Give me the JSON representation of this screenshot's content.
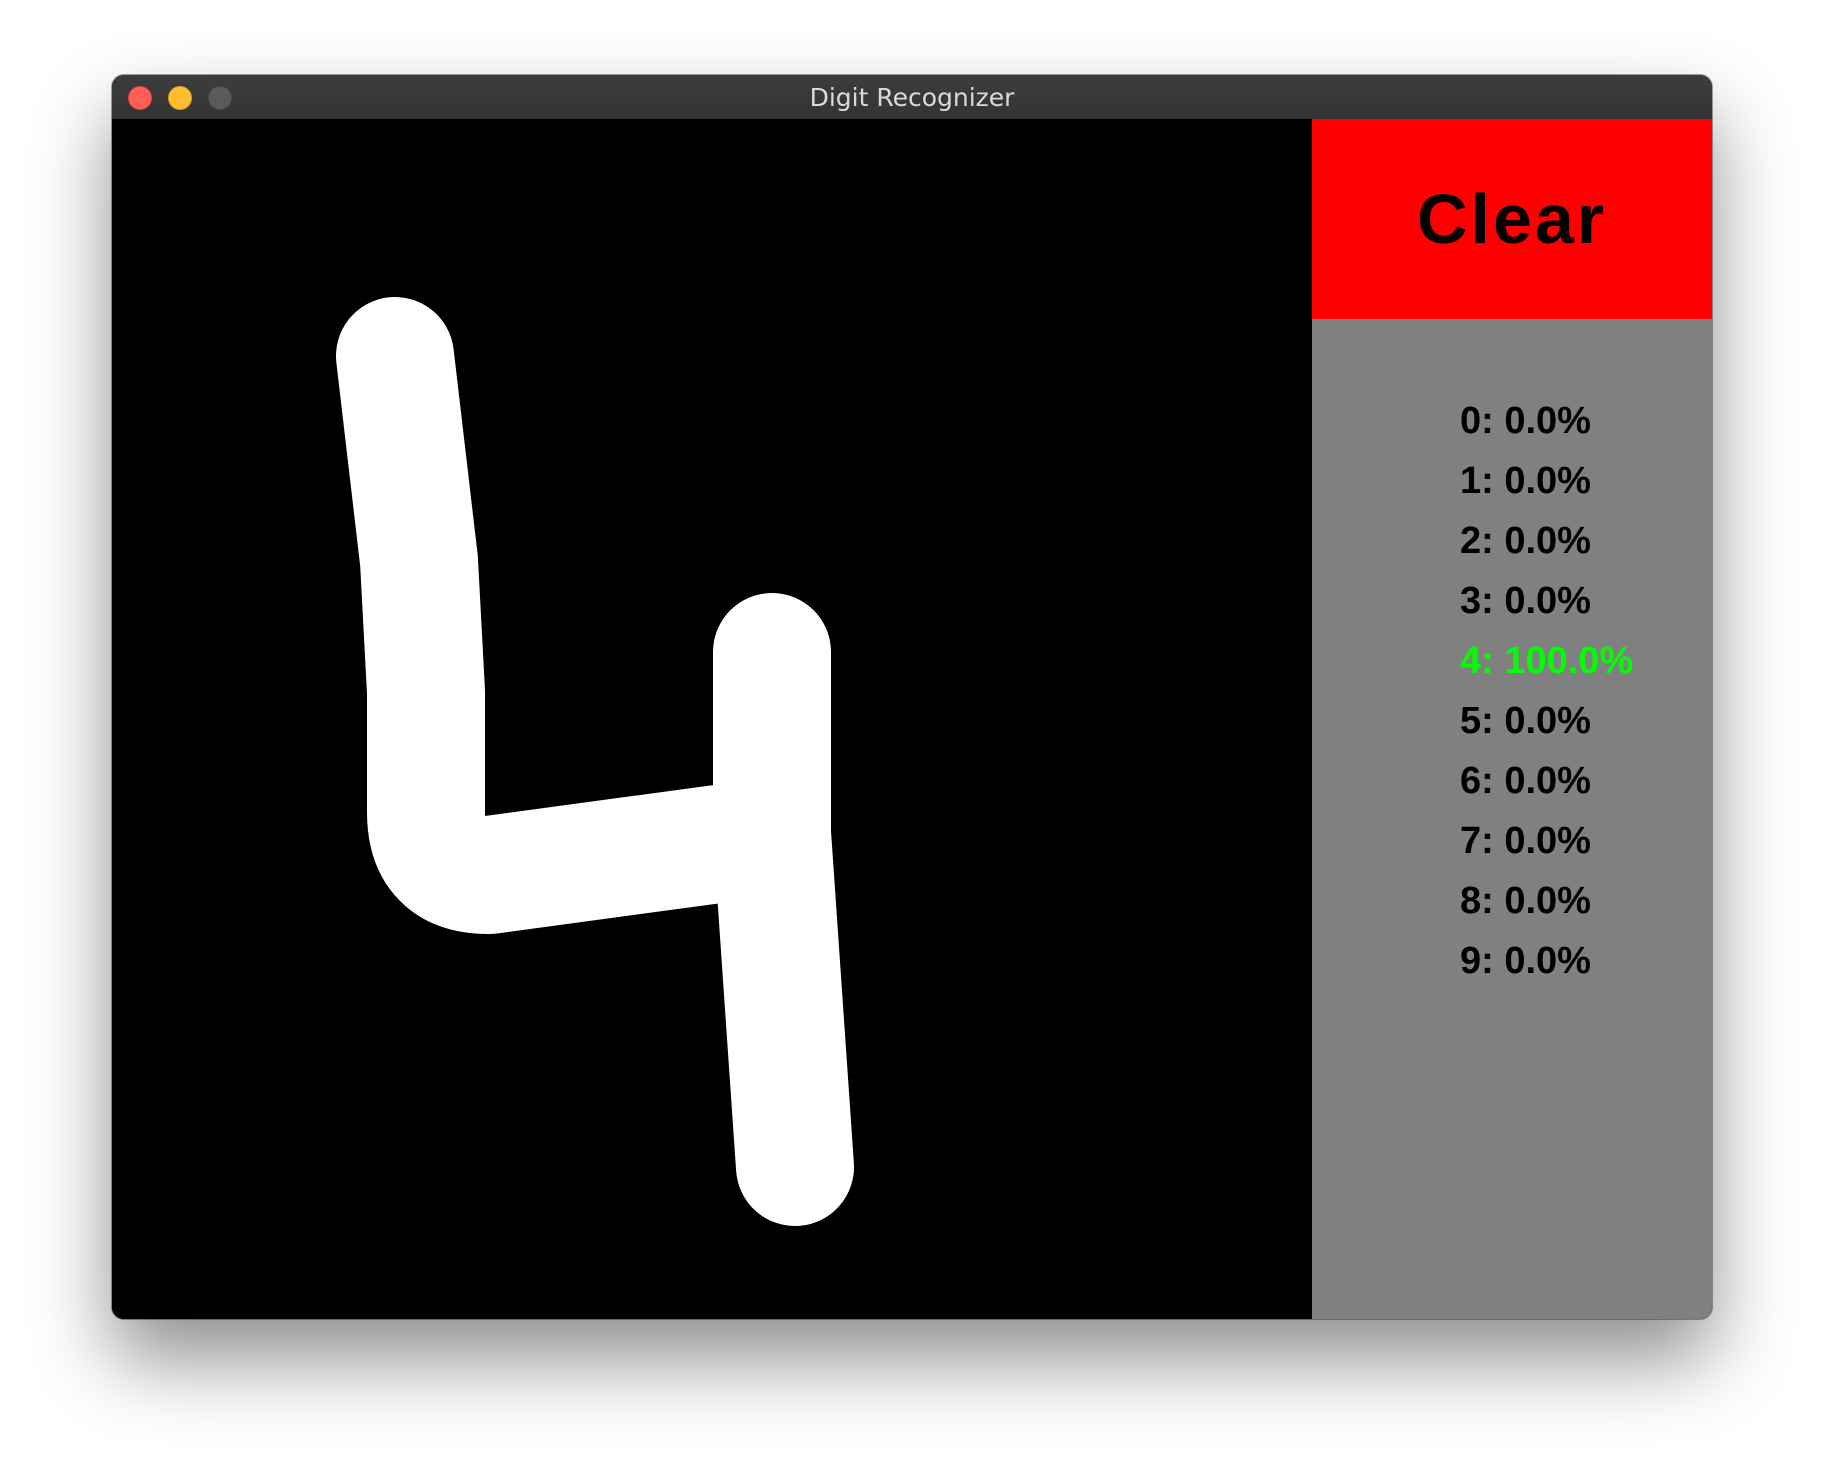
{
  "window": {
    "title": "Digit Recognizer"
  },
  "canvas": {
    "content": "handwritten digit stroke",
    "stroke_color": "#ffffff",
    "background": "#000000"
  },
  "sidebar": {
    "clear_label": "Clear",
    "clear_color": "#ff0000",
    "background": "#808080",
    "highlight_color": "#00ff00",
    "predictions": [
      {
        "text": "0: 0.0%",
        "digit": 0,
        "probability": 0.0,
        "top": false
      },
      {
        "text": "1: 0.0%",
        "digit": 1,
        "probability": 0.0,
        "top": false
      },
      {
        "text": "2: 0.0%",
        "digit": 2,
        "probability": 0.0,
        "top": false
      },
      {
        "text": "3: 0.0%",
        "digit": 3,
        "probability": 0.0,
        "top": false
      },
      {
        "text": "4: 100.0%",
        "digit": 4,
        "probability": 100.0,
        "top": true
      },
      {
        "text": "5: 0.0%",
        "digit": 5,
        "probability": 0.0,
        "top": false
      },
      {
        "text": "6: 0.0%",
        "digit": 6,
        "probability": 0.0,
        "top": false
      },
      {
        "text": "7: 0.0%",
        "digit": 7,
        "probability": 0.0,
        "top": false
      },
      {
        "text": "8: 0.0%",
        "digit": 8,
        "probability": 0.0,
        "top": false
      },
      {
        "text": "9: 0.0%",
        "digit": 9,
        "probability": 0.0,
        "top": false
      }
    ]
  }
}
